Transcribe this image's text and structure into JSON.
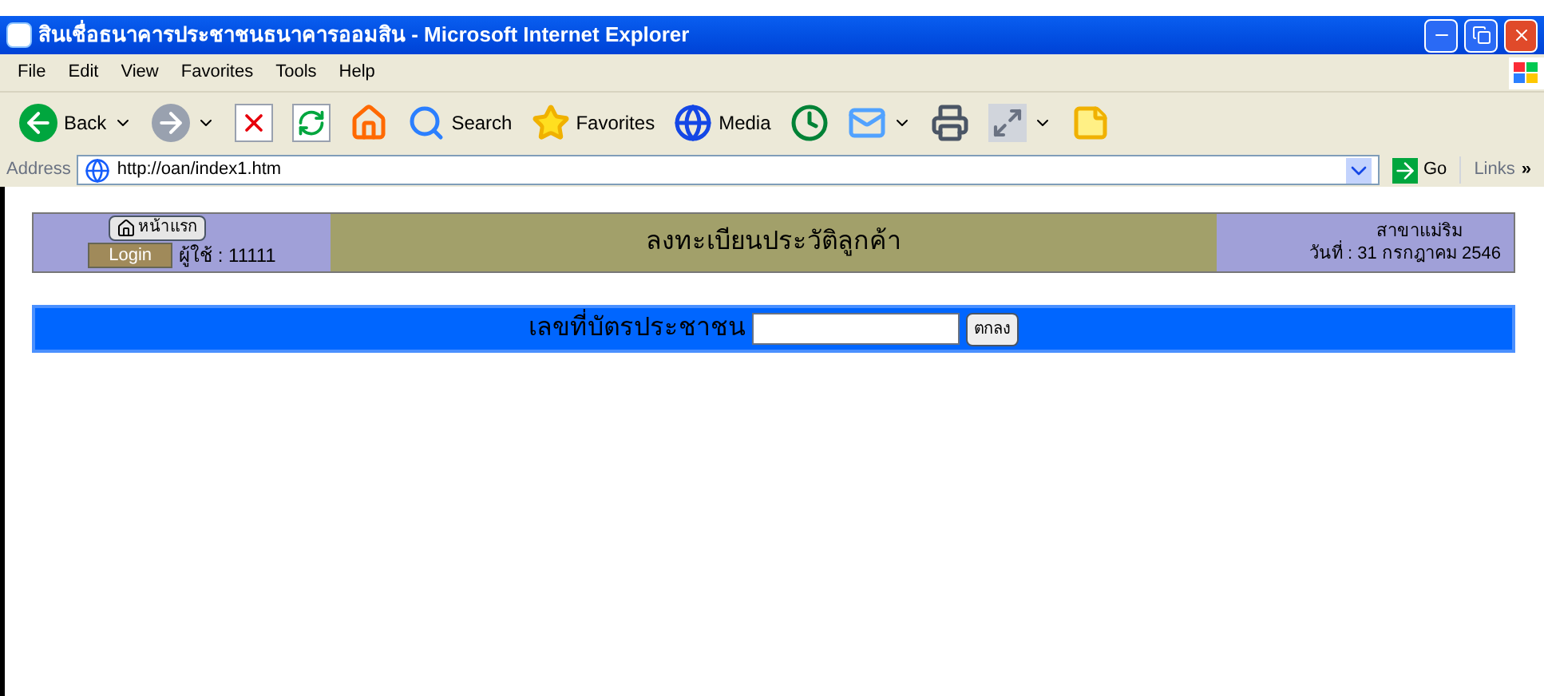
{
  "window": {
    "title": "สินเชื่อธนาคารประชาชนธนาคารออมสิน - Microsoft Internet Explorer"
  },
  "menu": [
    "File",
    "Edit",
    "View",
    "Favorites",
    "Tools",
    "Help"
  ],
  "toolbar": [
    {
      "kind": "back",
      "label": "Back",
      "dropdown": true
    },
    {
      "kind": "forward",
      "dropdown": true
    },
    {
      "kind": "stop"
    },
    {
      "kind": "refresh"
    },
    {
      "kind": "home"
    },
    {
      "kind": "search",
      "label": "Search"
    },
    {
      "kind": "favorites",
      "label": "Favorites"
    },
    {
      "kind": "media",
      "label": "Media"
    },
    {
      "kind": "history"
    },
    {
      "kind": "mail",
      "dropdown": true
    },
    {
      "kind": "print"
    },
    {
      "kind": "edit",
      "dropdown": true
    },
    {
      "kind": "note"
    }
  ],
  "address": {
    "label": "Address",
    "url": "http://oan/index1.htm",
    "go": "Go",
    "links": "Links",
    "links_more": "»"
  },
  "header": {
    "home_button": "หน้าแรก",
    "login_button": "Login",
    "user": "ผู้ใช้ : 11111",
    "title": "ลงทะเบียนประวัติลูกค้า",
    "branch": "สาขาแม่ริม",
    "date": "วันที่ : 31 กรกฎาคม 2546"
  },
  "search": {
    "label": "เลขที่บัตรประชาชน",
    "button": "ตกลง"
  }
}
